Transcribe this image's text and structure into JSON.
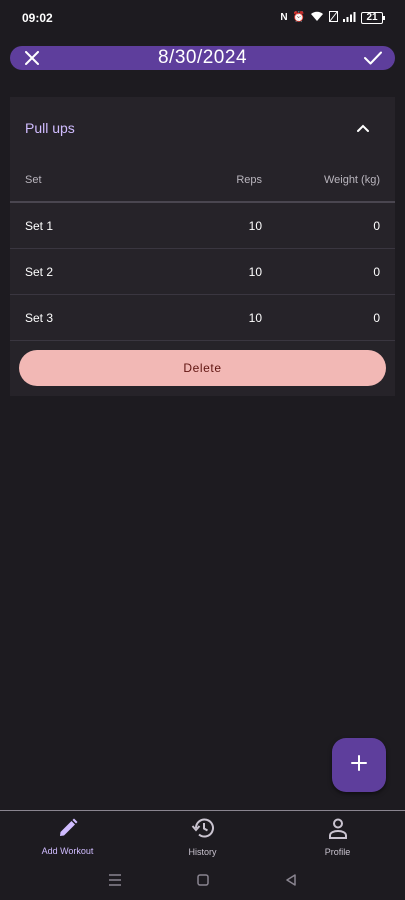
{
  "status_bar": {
    "time": "09:02",
    "battery": "21"
  },
  "top_bar": {
    "title": "8/30/2024",
    "close_icon": "close-icon",
    "confirm_icon": "check-icon"
  },
  "exercise": {
    "name": "Pull ups",
    "collapse_icon": "chevron-up-icon",
    "columns": {
      "set": "Set",
      "reps": "Reps",
      "weight": "Weight (kg)"
    },
    "sets": [
      {
        "set": "Set 1",
        "reps": "10",
        "weight": "0"
      },
      {
        "set": "Set 2",
        "reps": "10",
        "weight": "0"
      },
      {
        "set": "Set 3",
        "reps": "10",
        "weight": "0"
      }
    ],
    "delete_label": "Delete"
  },
  "fab": {
    "icon": "plus-icon"
  },
  "bottom_nav": {
    "items": [
      {
        "label": "Add Workout",
        "icon": "pencil-icon",
        "active": true
      },
      {
        "label": "History",
        "icon": "history-icon",
        "active": false
      },
      {
        "label": "Profile",
        "icon": "person-icon",
        "active": false
      }
    ]
  },
  "colors": {
    "background": "#1d1b20",
    "primary": "#5e3e9c",
    "accent_text": "#d0bcff",
    "delete_button": "#f2b8b5"
  }
}
